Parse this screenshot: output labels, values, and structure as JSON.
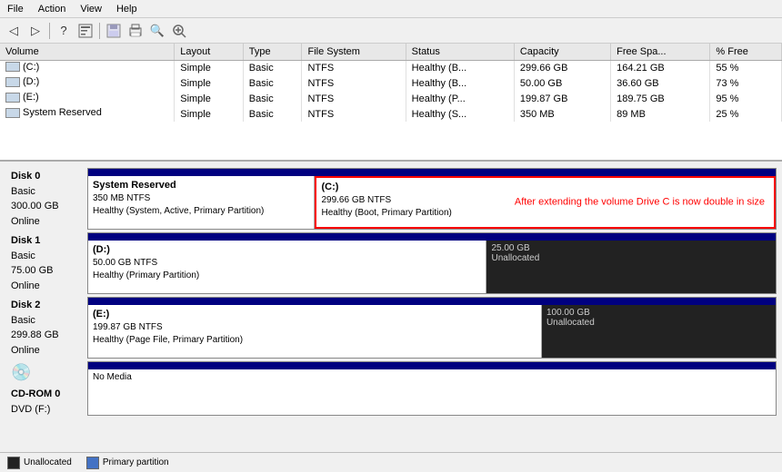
{
  "menu": {
    "items": [
      "File",
      "Action",
      "View",
      "Help"
    ]
  },
  "toolbar": {
    "buttons": [
      "←",
      "→",
      "?",
      "⊞",
      "💾",
      "🖨",
      "🔍",
      "🔍+"
    ]
  },
  "table": {
    "headers": [
      "Volume",
      "Layout",
      "Type",
      "File System",
      "Status",
      "Capacity",
      "Free Spa...",
      "% Free"
    ],
    "rows": [
      {
        "volume": "(C:)",
        "layout": "Simple",
        "type": "Basic",
        "fs": "NTFS",
        "status": "Healthy (B...",
        "capacity": "299.66 GB",
        "free": "164.21 GB",
        "pct": "55 %"
      },
      {
        "volume": "(D:)",
        "layout": "Simple",
        "type": "Basic",
        "fs": "NTFS",
        "status": "Healthy (B...",
        "capacity": "50.00 GB",
        "free": "36.60 GB",
        "pct": "73 %"
      },
      {
        "volume": "(E:)",
        "layout": "Simple",
        "type": "Basic",
        "fs": "NTFS",
        "status": "Healthy (P...",
        "capacity": "199.87 GB",
        "free": "189.75 GB",
        "pct": "95 %"
      },
      {
        "volume": "System Reserved",
        "layout": "Simple",
        "type": "Basic",
        "fs": "NTFS",
        "status": "Healthy (S...",
        "capacity": "350 MB",
        "free": "89 MB",
        "pct": "25 %"
      }
    ]
  },
  "disks": {
    "disk0": {
      "label": "Disk 0",
      "type": "Basic",
      "size": "300.00 GB",
      "status": "Online",
      "partitions": [
        {
          "name": "System Reserved",
          "size": "350 MB NTFS",
          "status": "Healthy (System, Active, Primary Partition)"
        },
        {
          "name": "(C:)",
          "size": "299.66 GB NTFS",
          "status": "Healthy (Boot, Primary Partition)",
          "annotation": "After extending the volume Drive C is now double in size"
        }
      ]
    },
    "disk1": {
      "label": "Disk 1",
      "type": "Basic",
      "size": "75.00 GB",
      "status": "Online",
      "partitions": [
        {
          "name": "(D:)",
          "size": "50.00 GB NTFS",
          "status": "Healthy (Primary Partition)"
        },
        {
          "name": "25.00 GB",
          "type": "unallocated",
          "label": "Unallocated"
        }
      ]
    },
    "disk2": {
      "label": "Disk 2",
      "type": "Basic",
      "size": "299.88 GB",
      "status": "Online",
      "partitions": [
        {
          "name": "(E:)",
          "size": "199.87 GB NTFS",
          "status": "Healthy (Page File, Primary Partition)"
        },
        {
          "name": "100.00 GB",
          "type": "unallocated",
          "label": "Unallocated"
        }
      ]
    },
    "cdrom": {
      "label": "CD-ROM 0",
      "type": "DVD (F:)",
      "status": "No Media"
    }
  },
  "legend": {
    "items": [
      "Unallocated",
      "Primary partition"
    ]
  }
}
